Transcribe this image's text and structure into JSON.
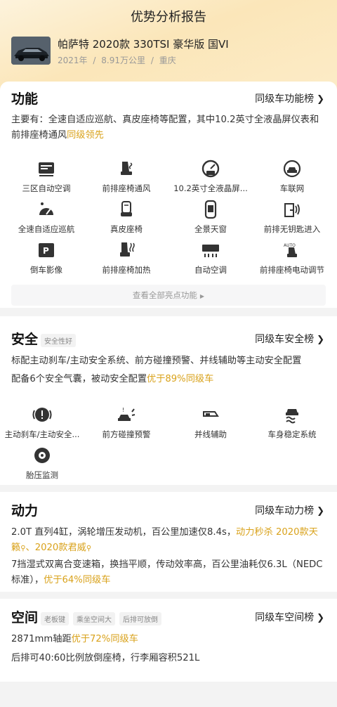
{
  "header": {
    "title": "优势分析报告",
    "car_name": "帕萨特 2020款 330TSI 豪华版 国VI",
    "car_year": "2021年",
    "car_mileage": "8.91万公里",
    "car_city": "重庆",
    "sep": "/"
  },
  "function": {
    "title": "功能",
    "rank_label": "同级车功能榜",
    "summary_prefix": "主要有：全速自适应巡航、真皮座椅等配置，其中10.2英寸全液晶屏仪表和前排座椅通风",
    "summary_highlight": "同级领先",
    "features": [
      {
        "label": "三区自动空调",
        "icon": "climate-icon"
      },
      {
        "label": "前排座椅通风",
        "icon": "seat-ventilation-icon"
      },
      {
        "label": "10.2英寸全液晶屏...",
        "icon": "lcd-gauge-icon"
      },
      {
        "label": "车联网",
        "icon": "connected-car-icon"
      },
      {
        "label": "全速自适应巡航",
        "icon": "cruise-icon"
      },
      {
        "label": "真皮座椅",
        "icon": "leather-seat-icon"
      },
      {
        "label": "全景天窗",
        "icon": "sunroof-icon"
      },
      {
        "label": "前排无钥匙进入",
        "icon": "keyless-entry-icon"
      },
      {
        "label": "倒车影像",
        "icon": "reverse-camera-icon"
      },
      {
        "label": "前排座椅加热",
        "icon": "seat-heating-icon"
      },
      {
        "label": "自动空调",
        "icon": "auto-ac-icon"
      },
      {
        "label": "前排座椅电动调节",
        "icon": "power-seat-icon"
      }
    ],
    "see_all": "查看全部亮点功能"
  },
  "safety": {
    "title": "安全",
    "tag": "安全性好",
    "rank_label": "同级车安全榜",
    "line1": "标配主动刹车/主动安全系统、前方碰撞预警、并线辅助等主动安全配置",
    "line2_prefix": "配备6个安全气囊，被动安全配置",
    "line2_highlight": "优于89%同级车",
    "features": [
      {
        "label": "主动刹车/主动安全...",
        "icon": "active-brake-icon"
      },
      {
        "label": "前方碰撞预警",
        "icon": "collision-warning-icon"
      },
      {
        "label": "并线辅助",
        "icon": "lane-assist-icon"
      },
      {
        "label": "车身稳定系统",
        "icon": "stability-icon"
      },
      {
        "label": "胎压监测",
        "icon": "tire-pressure-icon"
      }
    ]
  },
  "power": {
    "title": "动力",
    "rank_label": "同级车动力榜",
    "line1_prefix": "2.0T 直列4缸，涡轮增压发动机，百公里加速仅8.4s，",
    "line1_highlight_a": "动力秒杀 2020款天籁",
    "line1_sep": "、",
    "line1_highlight_b": "2020款君威",
    "line2_prefix": "7挡湿式双离合变速箱，换挡平顺，传动效率高，百公里油耗仅6.3L（NEDC标准），",
    "line2_highlight": "优于64%同级车"
  },
  "space": {
    "title": "空间",
    "tags": [
      "老板键",
      "乘坐空间大",
      "后排可放倒"
    ],
    "rank_label": "同级车空间榜",
    "line1_prefix": "2871mm轴距",
    "line1_highlight": "优于72%同级车",
    "line2": "后排可40:60比例放倒座椅，行李厢容积521L"
  },
  "colors": {
    "accent": "#d9a21b",
    "icon": "#333333"
  }
}
